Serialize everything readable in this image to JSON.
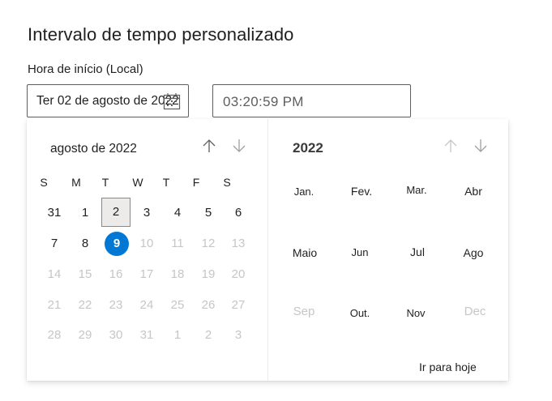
{
  "page": {
    "title": "Intervalo de tempo personalizado",
    "start_label": "Hora de início (Local)"
  },
  "date_input": {
    "value": "Ter 02 de agosto de 2022",
    "icon": "calendar-icon"
  },
  "time_input": {
    "value": "03:20:59 PM"
  },
  "calendar": {
    "month_label": "agosto de 2022",
    "weekdays": [
      "S",
      "M",
      "T",
      "W",
      "T",
      "F",
      "S"
    ],
    "weeks": [
      [
        "31",
        "1",
        "2",
        "3",
        "4",
        "5",
        "6"
      ],
      [
        "7",
        "8",
        "9",
        "10",
        "11",
        "12",
        "13"
      ],
      [
        "14",
        "15",
        "16",
        "17",
        "18",
        "19",
        "20"
      ],
      [
        "21",
        "22",
        "23",
        "24",
        "25",
        "26",
        "27"
      ],
      [
        "28",
        "29",
        "30",
        "31",
        "1",
        "2",
        "3"
      ]
    ],
    "selected_day": "2",
    "today_day": "9",
    "accent_color": "#0078d4"
  },
  "year_picker": {
    "year_label": "2022",
    "months": [
      "Jan.",
      "Fev.",
      "Mar.",
      "Abr",
      "Maio",
      "Jun",
      "Jul",
      "Ago",
      "Sep",
      "Out.",
      "Nov",
      "Dec"
    ],
    "goto_today": "Ir para hoje"
  }
}
